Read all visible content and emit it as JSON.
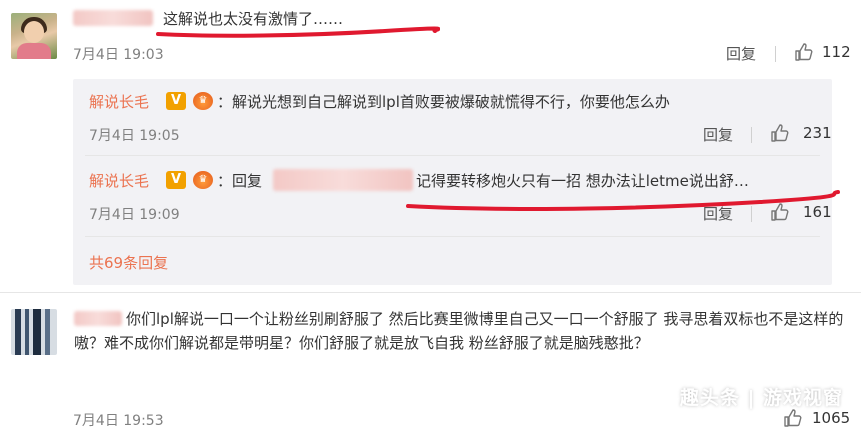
{
  "comments": [
    {
      "text": "这解说也太没有激情了……",
      "time": "7月4日 19:03",
      "reply_label": "回复",
      "likes": "112",
      "replies": [
        {
          "user": "解说长毛",
          "body": "：解说光想到自己解说到lpl首败要被爆破就慌得不行，你要他怎么办",
          "time": "7月4日 19:05",
          "reply_label": "回复",
          "likes": "231"
        },
        {
          "user": "解说长毛",
          "prefix": "：回复",
          "body": "记得要转移炮火只有一招   想办法让letme说出舒…",
          "time": "7月4日 19:09",
          "reply_label": "回复",
          "likes": "161"
        }
      ],
      "more_replies": "共69条回复"
    },
    {
      "text": "你们lpl解说一口一个让粉丝别刷舒服了 然后比赛里微博里自己又一口一个舒服了 我寻思着双标也不是这样的嗷？难不成你们解说都是带明星？你们舒服了就是放飞自我  粉丝舒服了就是脑残憨批？",
      "time": "7月4日 19:53",
      "likes": "1065"
    }
  ],
  "badges": {
    "v": "V",
    "crown": "♛"
  },
  "icons": {
    "like": "thumbs-up-icon",
    "vip": "vip-v-icon",
    "level": "crown-level-icon"
  },
  "colors": {
    "username": "#eb7350",
    "underline": "#e0192f",
    "panel_bg": "#f2f2f5"
  },
  "watermark": "趣头条 | 游戏视窗"
}
